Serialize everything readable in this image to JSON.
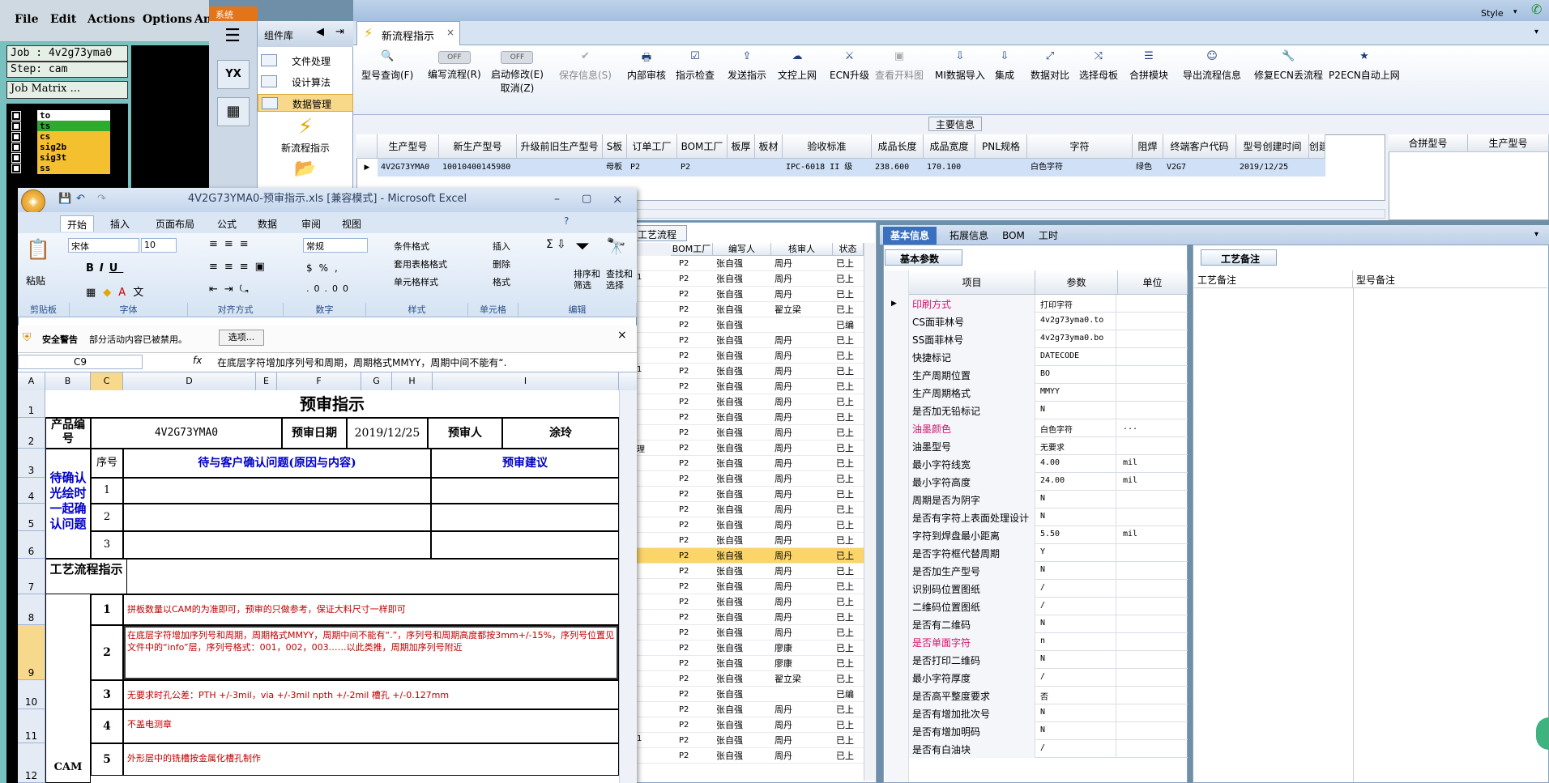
{
  "cam": {
    "menu": [
      "File",
      "Edit",
      "Actions",
      "Options",
      "Ana"
    ],
    "job": "Job : 4v2g73yma0",
    "step": "Step: cam",
    "job_matrix": "Job Matrix ...",
    "layers": [
      {
        "name": "to",
        "color": "#ffffff"
      },
      {
        "name": "ts",
        "color": "#2eaa2e"
      },
      {
        "name": "cs",
        "color": "#f5c030"
      },
      {
        "name": "sig2b",
        "color": "#f5c030"
      },
      {
        "name": "sig3t",
        "color": "#f5c030"
      },
      {
        "name": "ss",
        "color": "#f5c030"
      }
    ]
  },
  "system": {
    "tab": "系统",
    "yx_label": "YX"
  },
  "component_lib": {
    "title": "组件库",
    "items": [
      "文件处理",
      "设计算法",
      "数据管理"
    ],
    "new_process": "新流程指示"
  },
  "topbar": {
    "style": "Style"
  },
  "doc_tab": {
    "title": "新流程指示"
  },
  "ribbon": {
    "buttons": [
      {
        "label": "型号查询(F)",
        "icon": "🔍",
        "disabled": false
      },
      {
        "label": "编写流程(R)",
        "icon": "OFF",
        "disabled": false
      },
      {
        "label": "启动修改(E)",
        "sub": "取消(Z)",
        "icon": "OFF",
        "disabled": false
      },
      {
        "label": "保存信息(S)",
        "icon": "✔",
        "disabled": true
      },
      {
        "label": "内部审核",
        "icon": "🖶",
        "disabled": false
      },
      {
        "label": "指示检查",
        "icon": "☑",
        "disabled": false
      },
      {
        "label": "发送指示",
        "icon": "⇪",
        "disabled": false
      },
      {
        "label": "文控上网",
        "icon": "☁",
        "disabled": false
      },
      {
        "label": "ECN升级",
        "icon": "⚔",
        "disabled": false
      },
      {
        "label": "查看开料图",
        "icon": "▣",
        "disabled": true
      },
      {
        "label": "MI数据导入",
        "icon": "⇩",
        "disabled": false
      },
      {
        "label": "集成",
        "icon": "⇩",
        "disabled": false
      },
      {
        "label": "数据对比",
        "icon": "⤢",
        "disabled": false
      },
      {
        "label": "选择母板",
        "icon": "⤨",
        "disabled": false
      },
      {
        "label": "合拼模块",
        "icon": "☰",
        "disabled": false
      },
      {
        "label": "导出流程信息",
        "icon": "☺",
        "disabled": false
      },
      {
        "label": "修复ECN丢流程",
        "icon": "🔧",
        "disabled": false
      },
      {
        "label": "P2ECN自动上网",
        "icon": "★",
        "disabled": false
      }
    ]
  },
  "main_info": {
    "title": "主要信息",
    "columns": [
      "生产型号",
      "新生产型号",
      "升级前旧生产型号",
      "S板",
      "订单工厂",
      "BOM工厂",
      "板厚",
      "板材",
      "验收标准",
      "成品长度",
      "成品宽度",
      "PNL规格",
      "字符",
      "阻焊",
      "终端客户代码",
      "型号创建时间",
      "创建"
    ],
    "row": [
      "4V2G73YMA0",
      "10010400145980",
      "",
      "母板",
      "P2",
      "P2",
      "",
      "",
      "IPC-6018 II 级",
      "238.600",
      "170.100",
      "",
      "白色字符",
      "绿色",
      "V2G7",
      "2019/12/25",
      ""
    ],
    "right_columns": [
      "合拼型号",
      "生产型号"
    ]
  },
  "process": {
    "tab": "工艺流程",
    "columns": [
      "BOM工厂",
      "编写人",
      "核审人",
      "状态"
    ],
    "left_fragments": [
      "",
      "1",
      "",
      "",
      "",
      "",
      "",
      "1",
      "",
      "",
      "",
      "",
      "理",
      "",
      "",
      "",
      "",
      "",
      "",
      "",
      "",
      "",
      "",
      "",
      "",
      "",
      "",
      "",
      "",
      "",
      "",
      "1",
      "",
      ""
    ],
    "rows": [
      [
        "P2",
        "张自强",
        "周丹",
        "已上"
      ],
      [
        "P2",
        "张自强",
        "周丹",
        "已上"
      ],
      [
        "P2",
        "张自强",
        "周丹",
        "已上"
      ],
      [
        "P2",
        "张自强",
        "翟立梁",
        "已上"
      ],
      [
        "P2",
        "张自强",
        "",
        "已编"
      ],
      [
        "P2",
        "张自强",
        "周丹",
        "已上"
      ],
      [
        "P2",
        "张自强",
        "周丹",
        "已上"
      ],
      [
        "P2",
        "张自强",
        "周丹",
        "已上"
      ],
      [
        "P2",
        "张自强",
        "周丹",
        "已上"
      ],
      [
        "P2",
        "张自强",
        "周丹",
        "已上"
      ],
      [
        "P2",
        "张自强",
        "周丹",
        "已上"
      ],
      [
        "P2",
        "张自强",
        "周丹",
        "已上"
      ],
      [
        "P2",
        "张自强",
        "周丹",
        "已上"
      ],
      [
        "P2",
        "张自强",
        "周丹",
        "已上"
      ],
      [
        "P2",
        "张自强",
        "周丹",
        "已上"
      ],
      [
        "P2",
        "张自强",
        "周丹",
        "已上"
      ],
      [
        "P2",
        "张自强",
        "周丹",
        "已上"
      ],
      [
        "P2",
        "张自强",
        "周丹",
        "已上"
      ],
      [
        "P2",
        "张自强",
        "周丹",
        "已上"
      ],
      [
        "P2",
        "张自强",
        "周丹",
        "已上"
      ],
      [
        "P2",
        "张自强",
        "周丹",
        "已上"
      ],
      [
        "P2",
        "张自强",
        "周丹",
        "已上"
      ],
      [
        "P2",
        "张自强",
        "周丹",
        "已上"
      ],
      [
        "P2",
        "张自强",
        "周丹",
        "已上"
      ],
      [
        "P2",
        "张自强",
        "周丹",
        "已上"
      ],
      [
        "P2",
        "张自强",
        "廖康",
        "已上"
      ],
      [
        "P2",
        "张自强",
        "廖康",
        "已上"
      ],
      [
        "P2",
        "张自强",
        "翟立梁",
        "已上"
      ],
      [
        "P2",
        "张自强",
        "",
        "已编"
      ],
      [
        "P2",
        "张自强",
        "周丹",
        "已上"
      ],
      [
        "P2",
        "张自强",
        "周丹",
        "已上"
      ],
      [
        "P2",
        "张自强",
        "周丹",
        "已上"
      ],
      [
        "P2",
        "张自强",
        "周丹",
        "已上"
      ]
    ],
    "highlight_index": 19
  },
  "tabs2": [
    "基本信息",
    "拓展信息",
    "BOM",
    "工时"
  ],
  "params": {
    "tab": "基本参数",
    "columns": [
      "项目",
      "参数",
      "单位"
    ],
    "rows": [
      {
        "name": "印刷方式",
        "value": "打印字符",
        "unit": "",
        "pink": true
      },
      {
        "name": "CS面菲林号",
        "value": "4v2g73yma0.to",
        "unit": "",
        "pink": false
      },
      {
        "name": "SS面菲林号",
        "value": "4v2g73yma0.bo",
        "unit": "",
        "pink": false
      },
      {
        "name": "快捷标记",
        "value": "DATECODE",
        "unit": "",
        "pink": false
      },
      {
        "name": "生产周期位置",
        "value": "BO",
        "unit": "",
        "pink": false
      },
      {
        "name": "生产周期格式",
        "value": "MMYY",
        "unit": "",
        "pink": false
      },
      {
        "name": "是否加无铅标记",
        "value": "N",
        "unit": "",
        "pink": false
      },
      {
        "name": "油墨颜色",
        "value": "白色字符",
        "unit": "...",
        "pink": true
      },
      {
        "name": "油墨型号",
        "value": "无要求",
        "unit": "",
        "pink": false
      },
      {
        "name": "最小字符线宽",
        "value": "4.00",
        "unit": "mil",
        "pink": false
      },
      {
        "name": "最小字符高度",
        "value": "24.00",
        "unit": "mil",
        "pink": false
      },
      {
        "name": "周期是否为阴字",
        "value": "N",
        "unit": "",
        "pink": false
      },
      {
        "name": "是否有字符上表面处理设计",
        "value": "N",
        "unit": "",
        "pink": false
      },
      {
        "name": "字符到焊盘最小距离",
        "value": "5.50",
        "unit": "mil",
        "pink": false
      },
      {
        "name": "是否字符框代替周期",
        "value": "Y",
        "unit": "",
        "pink": false
      },
      {
        "name": "是否加生产型号",
        "value": "N",
        "unit": "",
        "pink": false
      },
      {
        "name": "识别码位置图纸",
        "value": "/",
        "unit": "",
        "pink": false
      },
      {
        "name": "二维码位置图纸",
        "value": "/",
        "unit": "",
        "pink": false
      },
      {
        "name": "是否有二维码",
        "value": "N",
        "unit": "",
        "pink": false
      },
      {
        "name": "是否单面字符",
        "value": "n",
        "unit": "",
        "pink": true
      },
      {
        "name": "是否打印二维码",
        "value": "N",
        "unit": "",
        "pink": false
      },
      {
        "name": "最小字符厚度",
        "value": "/",
        "unit": "",
        "pink": false
      },
      {
        "name": "是否高平整度要求",
        "value": "否",
        "unit": "",
        "pink": false
      },
      {
        "name": "是否有增加批次号",
        "value": "N",
        "unit": "",
        "pink": false
      },
      {
        "name": "是否有增加明码",
        "value": "N",
        "unit": "",
        "pink": false
      },
      {
        "name": "是否有白油块",
        "value": "/",
        "unit": "",
        "pink": false
      }
    ]
  },
  "remarks": {
    "tab": "工艺备注",
    "col1": "工艺备注",
    "col2": "型号备注"
  },
  "excel": {
    "title": "4V2G73YMA0-预审指示.xls  [兼容模式] - Microsoft Excel",
    "tabs": [
      "开始",
      "插入",
      "页面布局",
      "公式",
      "数据",
      "审阅",
      "视图"
    ],
    "font_name": "宋体",
    "font_size": "10",
    "number_format": "常规",
    "groups": [
      "剪贴板",
      "字体",
      "对齐方式",
      "数字",
      "样式",
      "单元格",
      "编辑"
    ],
    "style_items": [
      "条件格式",
      "套用表格格式",
      "单元格样式"
    ],
    "cell_items": [
      "插入",
      "删除",
      "格式"
    ],
    "edit_items": [
      "排序和筛选",
      "查找和选择"
    ],
    "paste": "粘贴",
    "security_label": "安全警告",
    "security_text": "部分活动内容已被禁用。",
    "options_button": "选项...",
    "name_box": "C9",
    "formula": "在底层字符增加序列号和周期，周期格式MMYY，周期中间不能有“.",
    "columns": [
      "A",
      "B",
      "C",
      "D",
      "E",
      "F",
      "G",
      "H",
      "I"
    ],
    "rows": [
      "1",
      "2",
      "3",
      "4",
      "5",
      "6",
      "7",
      "8",
      "9",
      "10",
      "11",
      "12"
    ],
    "sheet": {
      "title": "预审指示",
      "product_label": "产品编号",
      "product_value": "4V2G73YMA0",
      "date_label": "预审日期",
      "date_value": "2019/12/25",
      "reviewer_label": "预审人",
      "reviewer_value": "涂玲",
      "pending_label": "待确认光绘时一起确认问题",
      "seq_label": "序号",
      "issue_label": "待与客户确认问题(原因与内容)",
      "advice_label": "预审建议",
      "seq": [
        "1",
        "2",
        "3"
      ],
      "process_label": "工艺流程指示",
      "cam_label": "CAM",
      "notes": [
        {
          "n": "1",
          "text": "拼板数量以CAM的为准即可，预审的只做参考，保证大料尺寸一样即可"
        },
        {
          "n": "2",
          "text": "在底层字符增加序列号和周期，周期格式MMYY，周期中间不能有“.”，序列号和周期高度都按3mm+/-15%，序列号位置见文件中的“info”层，序列号格式：001，002，003……以此类推，周期加序列号附近"
        },
        {
          "n": "3",
          "text": "无要求时孔公差：PTH +/-3mil，via +/-3mil npth +/-2mil   槽孔 +/-0.127mm"
        },
        {
          "n": "4",
          "text": "不盖电测章"
        },
        {
          "n": "5",
          "text": "外形层中的铣槽按金属化槽孔制作"
        }
      ]
    }
  }
}
